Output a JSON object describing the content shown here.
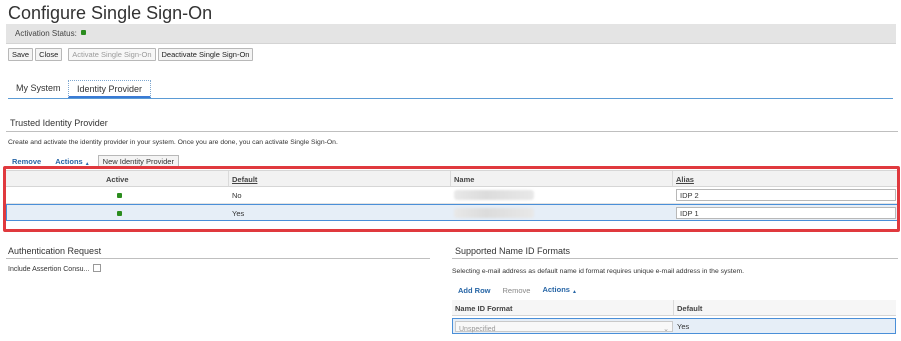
{
  "page": {
    "title": "Configure Single Sign-On",
    "activation_status_label": "Activation Status:",
    "activation_status_color": "#2b8c1e"
  },
  "toolbar": {
    "save": "Save",
    "close": "Close",
    "activate": "Activate Single Sign-On",
    "deactivate": "Deactivate Single Sign-On"
  },
  "tabs": [
    {
      "label": "My System",
      "active": false
    },
    {
      "label": "Identity Provider",
      "active": true
    }
  ],
  "trusted_idp": {
    "title": "Trusted Identity Provider",
    "description": "Create and activate the identity provider in your system. Once you are done, you can activate Single Sign-On.",
    "toolbar": {
      "remove": "Remove",
      "actions": "Actions",
      "new_idp": "New Identity Provider"
    },
    "columns": {
      "active": "Active",
      "default": "Default",
      "name": "Name",
      "alias": "Alias"
    },
    "rows": [
      {
        "active": true,
        "default": "No",
        "name": "",
        "alias": "IDP 2",
        "selected": false
      },
      {
        "active": true,
        "default": "Yes",
        "name": "",
        "alias": "IDP 1",
        "selected": true
      }
    ]
  },
  "auth_request": {
    "title": "Authentication Request",
    "include_assertion_label": "Include Assertion Consu..."
  },
  "name_id": {
    "title": "Supported Name ID Formats",
    "description": "Selecting e-mail address as default name id format requires unique e-mail address in the system.",
    "toolbar": {
      "add_row": "Add Row",
      "remove": "Remove",
      "actions": "Actions"
    },
    "columns": {
      "format": "Name ID Format",
      "default": "Default"
    },
    "rows": [
      {
        "format": "Unspecified",
        "default": "Yes"
      }
    ]
  }
}
